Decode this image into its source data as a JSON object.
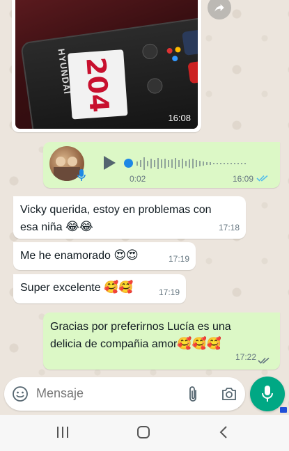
{
  "chat": {
    "image_message": {
      "time": "16:08",
      "label_number": "204",
      "brand": "HYUNDAI"
    },
    "voice_message": {
      "duration": "0:02",
      "time": "16:09"
    },
    "messages_in": [
      {
        "line1": "Vicky querida, estoy en problemas con",
        "line2": "esa niña",
        "emoji": "😂😂",
        "time": "17:18"
      },
      {
        "text": "Me he enamorado",
        "emoji": "😍😍",
        "time": "17:19"
      },
      {
        "text": "Super excelente",
        "emoji": "🥰🥰",
        "time": "17:19"
      }
    ],
    "message_out": {
      "line1": "Gracias por preferirnos Lucía es una",
      "line2": "delicia de compañia amor",
      "emoji": "🥰🥰🥰",
      "time": "17:22"
    }
  },
  "composer": {
    "placeholder": "Mensaje"
  },
  "icons": {
    "forward": "forward-icon",
    "emoji": "emoji-icon",
    "attach": "paperclip-icon",
    "camera": "camera-icon",
    "mic": "mic-icon"
  },
  "colors": {
    "outgoing_bubble": "#dcf8c6",
    "incoming_bubble": "#ffffff",
    "accent": "#00a884",
    "read_ticks": "#53bdeb"
  }
}
